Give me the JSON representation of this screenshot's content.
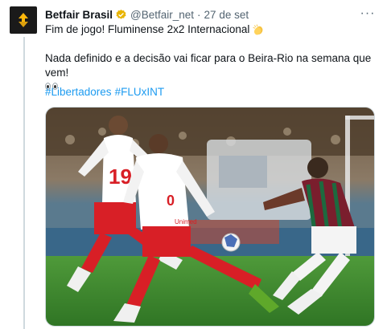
{
  "tweet": {
    "display_name": "Betfair Brasil",
    "handle": "@Betfair_net",
    "separator": "·",
    "date": "27 de set",
    "more_label": "···",
    "line1": "Fim de jogo! Fluminense 2x2 Internacional",
    "line2": "Nada definido e a decisão vai ficar para o Beira-Rio na semana que vem!",
    "hashtags": [
      "#Libertadores",
      "#FLUxINT"
    ]
  },
  "media": {
    "home_shirt_number": "19",
    "away_shirt_number": "0",
    "shirt_sponsor": "Unimed"
  },
  "colors": {
    "accent": "#1d9bf0",
    "verified_gold": "#e8b400",
    "internacional_red": "#d81f26",
    "fluminense_maroon": "#7a1e2d",
    "fluminense_green": "#1d6a3f",
    "pitch_green": "#3f8a2e"
  },
  "icons": {
    "avatar": "betfair-arrows-logo",
    "verified": "verified-gold-badge",
    "emoji1": "clapping-hands-emoji",
    "emoji2": "eyes-emoji",
    "more": "more-options-icon"
  }
}
